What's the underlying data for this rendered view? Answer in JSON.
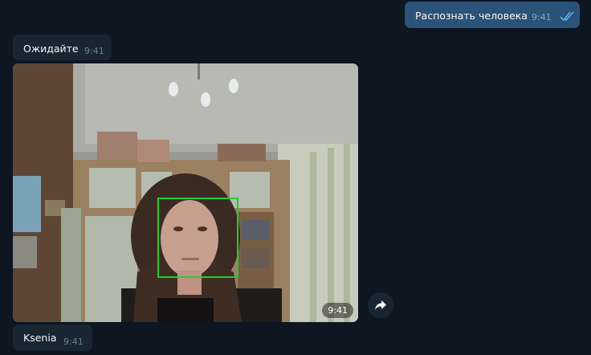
{
  "messages": {
    "outgoing_request": {
      "text": "Распознать человека",
      "time": "9:41",
      "status_icon": "double-check-icon"
    },
    "incoming_wait": {
      "text": "Ожидайте",
      "time": "9:41"
    },
    "photo": {
      "time": "9:41",
      "content": "webcam-photo",
      "detection_box_color": "#22cc33"
    },
    "incoming_name": {
      "text": "Ksenia",
      "time": "9:41"
    }
  },
  "actions": {
    "share_icon": "share-arrow-icon"
  },
  "colors": {
    "background": "#0e1621",
    "outgoing_bubble": "#2b5278",
    "incoming_bubble": "#182533",
    "tick": "#5eb5f7"
  }
}
